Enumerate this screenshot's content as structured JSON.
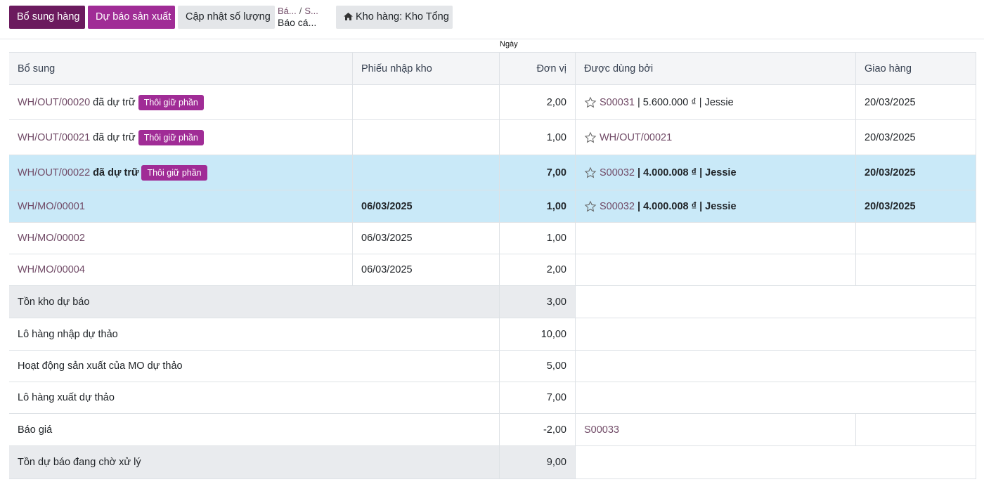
{
  "toolbar": {
    "replenish_label": "Bổ sung hàng",
    "forecast_mo_label": "Dự báo sản xuất",
    "update_qty_label": "Cập nhật số lượng",
    "warehouse_label": "Kho hàng: Kho Tổng"
  },
  "breadcrumb": {
    "first": "Bá...",
    "second": "S...",
    "current": "Báo cá..."
  },
  "date_header": "Ngày",
  "table": {
    "headers": [
      "Bổ sung",
      "Phiếu nhập kho",
      "Đơn vị",
      "Được dùng bởi",
      "Giao hàng"
    ],
    "rows": [
      {
        "ref": "WH/OUT/00020",
        "suffix": "đã dự trữ",
        "tag": "Thôi giữ phần",
        "receipt": "",
        "qty": "2,00",
        "used_by": "S00031",
        "used_by_rest": "| 5.600.000 ₫ | Jessie",
        "delivery": "20/03/2025"
      },
      {
        "ref": "WH/OUT/00021",
        "suffix": "đã dự trữ",
        "tag": "Thôi giữ phần",
        "receipt": "",
        "qty": "1,00",
        "used_by": "WH/OUT/00021",
        "used_by_rest": "",
        "delivery": "20/03/2025"
      },
      {
        "ref": "WH/OUT/00022",
        "suffix": "đã dự trữ",
        "tag": "Thôi giữ phần",
        "receipt": "",
        "qty": "7,00",
        "used_by": "S00032",
        "used_by_rest": "| 4.000.008 ₫ | Jessie",
        "delivery": "20/03/2025"
      },
      {
        "ref": "WH/MO/00001",
        "receipt": "06/03/2025",
        "qty": "1,00",
        "used_by": "S00032",
        "used_by_rest": "| 4.000.008 ₫ | Jessie",
        "delivery": "20/03/2025"
      },
      {
        "ref": "WH/MO/00002",
        "receipt": "06/03/2025",
        "qty": "1,00"
      },
      {
        "ref": "WH/MO/00004",
        "receipt": "06/03/2025",
        "qty": "2,00"
      }
    ],
    "summary": [
      {
        "label": "Tồn kho dự báo",
        "qty": "3,00"
      },
      {
        "label": "Lô hàng nhập dự thảo",
        "qty": "10,00"
      },
      {
        "label": "Hoạt động sản xuất của MO dự thảo",
        "qty": "5,00"
      },
      {
        "label": "Lô hàng xuất dự thảo",
        "qty": "7,00"
      },
      {
        "label": "Báo giá",
        "qty": "-2,00",
        "used_by": "S00033"
      },
      {
        "label": "Tồn dự báo đang chờ xử lý",
        "qty": "9,00"
      }
    ]
  },
  "colors": {
    "primary_dark": "#6b1a5e",
    "primary": "#a02c96",
    "link": "#714b67",
    "highlight_row": "#c9e9f8",
    "summary_grey": "#e9ebee"
  },
  "icons": {
    "warehouse": "home-icon",
    "favorite": "star-icon"
  }
}
